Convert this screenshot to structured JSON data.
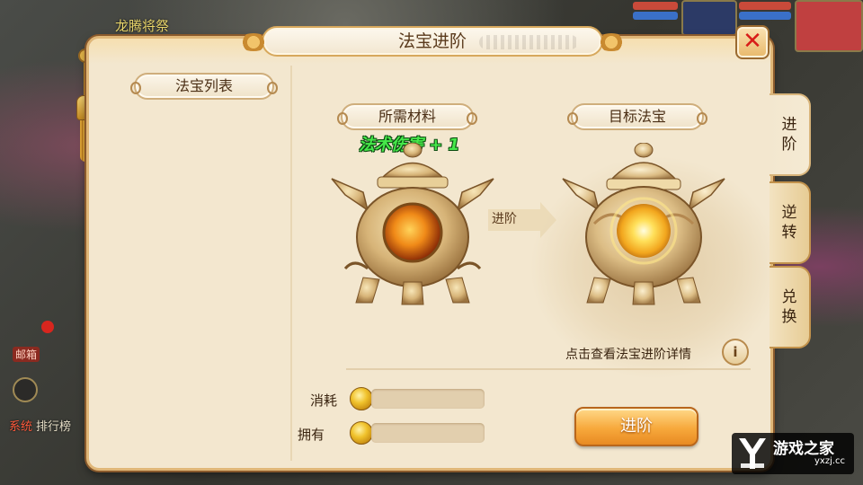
{
  "background": {
    "top_text": "龙腾将祭",
    "system_tag": "系统",
    "system_text": "排行榜",
    "mail_label": "邮箱"
  },
  "window": {
    "title": "法宝进阶",
    "close_icon": "close-icon"
  },
  "list": {
    "title": "法宝列表"
  },
  "advance": {
    "material_title": "所需材料",
    "target_title": "目标法宝",
    "effect_text": "法术伤害 + 1",
    "arrow_label": "进阶",
    "details_text": "点击查看法宝进阶详情",
    "info_icon_glyph": "i"
  },
  "resources": {
    "consume_label": "消耗",
    "consume_value": "",
    "own_label": "拥有",
    "own_value": ""
  },
  "buttons": {
    "advance_label": "进阶"
  },
  "tabs": [
    {
      "char1": "进",
      "char2": "阶",
      "active": true
    },
    {
      "char1": "逆",
      "char2": "转",
      "active": false
    },
    {
      "char1": "兑",
      "char2": "换",
      "active": false
    }
  ],
  "watermark": {
    "name": "游戏之家",
    "url": "yxzj.cc"
  },
  "colors": {
    "panel_bg": "#f3e7cf",
    "panel_border": "#e0b778",
    "effect_green": "#46e84a",
    "button_orange": "#f7a93c",
    "close_red": "#d81c18"
  }
}
